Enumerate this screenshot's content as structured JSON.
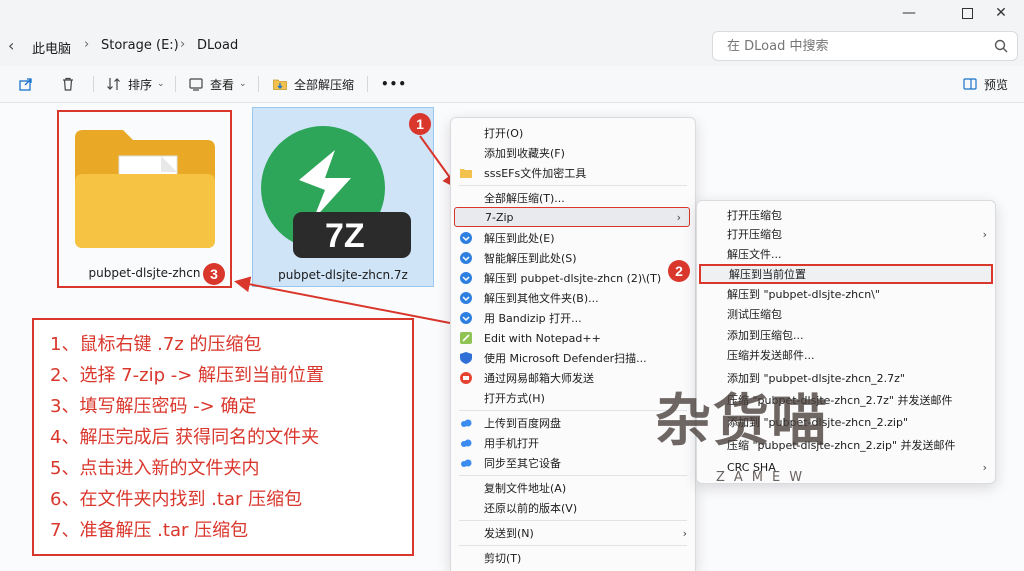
{
  "address": {
    "crumbs": [
      "此电脑",
      "Storage (E:)",
      "DLoad"
    ],
    "search_placeholder": "在 DLoad 中搜索"
  },
  "toolbar": {
    "sort_label": "排序",
    "view_label": "查看",
    "extract_all_label": "全部解压缩",
    "more_label": "•••",
    "preview_label": "预览"
  },
  "files": {
    "folder_name": "pubpet-dlsjte-zhcn",
    "archive_name": "pubpet-dlsjte-zhcn.7z",
    "archive_badge": "7Z"
  },
  "badges": {
    "one": "1",
    "two": "2",
    "three": "3"
  },
  "steps": [
    "1、鼠标右键 .7z 的压缩包",
    "2、选择 7-zip -> 解压到当前位置",
    "3、填写解压密码 -> 确定",
    "4、解压完成后 获得同名的文件夹",
    "5、点击进入新的文件夹内",
    "6、在文件夹内找到 .tar 压缩包",
    "7、准备解压 .tar 压缩包"
  ],
  "context_menu": {
    "items": [
      "打开(O)",
      "添加到收藏夹(F)",
      "sssEFs文件加密工具",
      "全部解压缩(T)...",
      "7-Zip",
      "解压到此处(E)",
      "智能解压到此处(S)",
      "解压到 pubpet-dlsjte-zhcn (2)\\(T)",
      "解压到其他文件夹(B)...",
      "用 Bandizip 打开...",
      "Edit with Notepad++",
      "使用 Microsoft Defender扫描...",
      "通过网易邮箱大师发送",
      "打开方式(H)",
      "上传到百度网盘",
      "用手机打开",
      "同步至其它设备",
      "复制文件地址(A)",
      "还原以前的版本(V)",
      "发送到(N)",
      "剪切(T)"
    ]
  },
  "submenu_7zip": {
    "items": [
      "打开压缩包",
      "打开压缩包",
      "解压文件...",
      "解压到当前位置",
      "解压到 \"pubpet-dlsjte-zhcn\\\"",
      "测试压缩包",
      "添加到压缩包...",
      "压缩并发送邮件...",
      "添加到 \"pubpet-dlsjte-zhcn_2.7z\"",
      "压缩 \"pubpet-dlsjte-zhcn_2.7z\" 并发送邮件",
      "添加到 \"pubpet-dlsjte-zhcn_2.zip\"",
      "压缩 \"pubpet-dlsjte-zhcn_2.zip\" 并发送邮件",
      "CRC SHA"
    ]
  },
  "watermark": {
    "main": "杂货喵",
    "sub": "ZAMEW"
  },
  "colors": {
    "accent_red": "#d9362c",
    "green_7z": "#2ea65a",
    "folder_yellow": "#f6c343"
  }
}
